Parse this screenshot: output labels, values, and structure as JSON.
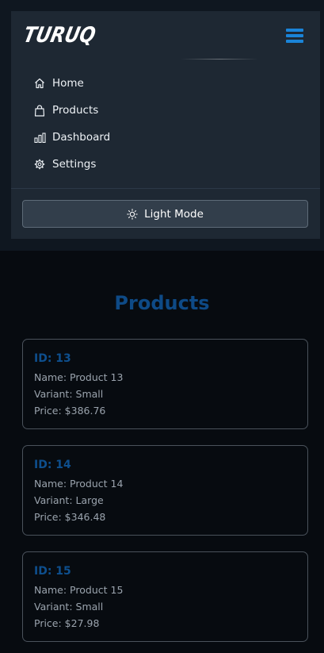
{
  "header": {
    "logo_text": "TURUQ",
    "menu_button": "hamburger-menu"
  },
  "nav": {
    "items": [
      {
        "label": "Home",
        "icon": "home-icon"
      },
      {
        "label": "Products",
        "icon": "shopping-bag-icon"
      },
      {
        "label": "Dashboard",
        "icon": "bar-chart-icon"
      },
      {
        "label": "Settings",
        "icon": "gear-icon"
      }
    ],
    "mode_button": {
      "label": "Light Mode",
      "icon": "sun-icon"
    }
  },
  "main": {
    "title": "Products",
    "products": [
      {
        "id": "ID: 13",
        "name": "Name: Product 13",
        "variant": "Variant: Small",
        "price": "Price: $386.76"
      },
      {
        "id": "ID: 14",
        "name": "Name: Product 14",
        "variant": "Variant: Large",
        "price": "Price: $346.48"
      },
      {
        "id": "ID: 15",
        "name": "Name: Product 15",
        "variant": "Variant: Small",
        "price": "Price: $27.98"
      }
    ]
  },
  "colors": {
    "accent": "#1a84d8",
    "title": "#0e4a86",
    "background": "#070b10",
    "nav_panel": "#1e2833"
  }
}
